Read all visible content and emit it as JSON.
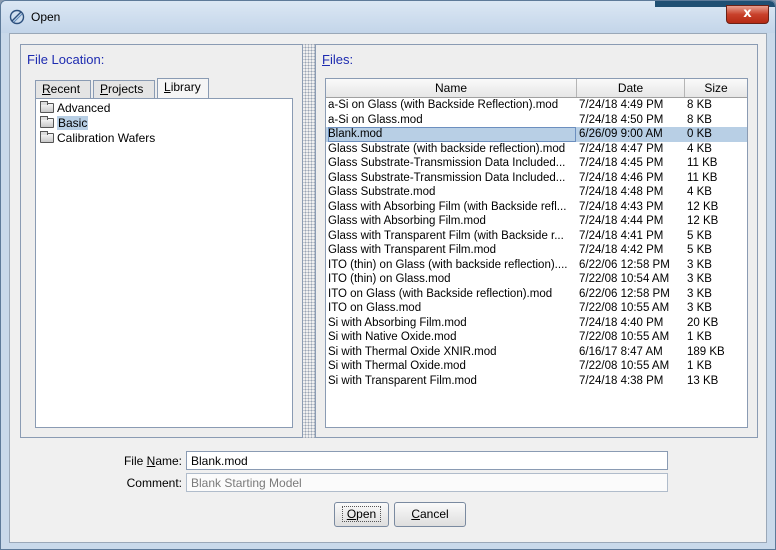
{
  "window": {
    "title": "Open",
    "close_glyph": "x",
    "icon": "open-app-icon"
  },
  "left": {
    "label_prefix": "File Location:",
    "tabs": [
      {
        "u": "R",
        "rest": "ecent"
      },
      {
        "u": "P",
        "rest": "rojects"
      },
      {
        "u": "L",
        "rest": "ibrary"
      }
    ],
    "tree": [
      "Advanced",
      "Basic",
      "Calibration Wafers"
    ],
    "selected_tree": "Basic"
  },
  "right": {
    "label_u": "F",
    "label_rest": "iles:",
    "columns": [
      "Name",
      "Date",
      "Size"
    ],
    "rows": [
      [
        "a-Si on Glass (with Backside Reflection).mod",
        "7/24/18 4:49 PM",
        "8 KB"
      ],
      [
        "a-Si on Glass.mod",
        "7/24/18 4:50 PM",
        "8 KB"
      ],
      [
        "Blank.mod",
        "6/26/09 9:00 AM",
        "0 KB"
      ],
      [
        "Glass Substrate (with backside reflection).mod",
        "7/24/18 4:47 PM",
        "4 KB"
      ],
      [
        "Glass Substrate-Transmission Data Included...",
        "7/24/18 4:45 PM",
        "11 KB"
      ],
      [
        "Glass Substrate-Transmission Data Included...",
        "7/24/18 4:46 PM",
        "11 KB"
      ],
      [
        "Glass Substrate.mod",
        "7/24/18 4:48 PM",
        "4 KB"
      ],
      [
        "Glass with Absorbing Film (with Backside refl...",
        "7/24/18 4:43 PM",
        "12 KB"
      ],
      [
        "Glass with Absorbing Film.mod",
        "7/24/18 4:44 PM",
        "12 KB"
      ],
      [
        "Glass with Transparent Film (with Backside r...",
        "7/24/18 4:41 PM",
        "5 KB"
      ],
      [
        "Glass with Transparent Film.mod",
        "7/24/18 4:42 PM",
        "5 KB"
      ],
      [
        "ITO (thin) on Glass (with backside reflection)....",
        "6/22/06 12:58 PM",
        "3 KB"
      ],
      [
        "ITO (thin) on Glass.mod",
        "7/22/08 10:54 AM",
        "3 KB"
      ],
      [
        "ITO on Glass (with Backside reflection).mod",
        "6/22/06 12:58 PM",
        "3 KB"
      ],
      [
        "ITO on Glass.mod",
        "7/22/08 10:55 AM",
        "3 KB"
      ],
      [
        "Si with Absorbing Film.mod",
        "7/24/18 4:40 PM",
        "20 KB"
      ],
      [
        "Si with Native Oxide.mod",
        "7/22/08 10:55 AM",
        "1 KB"
      ],
      [
        "Si with Thermal Oxide XNIR.mod",
        "6/16/17 8:47 AM",
        "189 KB"
      ],
      [
        "Si with Thermal Oxide.mod",
        "7/22/08 10:55 AM",
        "1 KB"
      ],
      [
        "Si with Transparent Film.mod",
        "7/24/18 4:38 PM",
        "13 KB"
      ]
    ],
    "selected_row": "Blank.mod"
  },
  "form": {
    "file_name_label_a": "File ",
    "file_name_label_u": "N",
    "file_name_label_b": "ame:",
    "file_name_value": "Blank.mod",
    "comment_label": "Comment:",
    "comment_value": "Blank Starting Model"
  },
  "buttons": {
    "open_u": "O",
    "open_rest": "pen",
    "cancel_u": "C",
    "cancel_rest": "ancel"
  }
}
